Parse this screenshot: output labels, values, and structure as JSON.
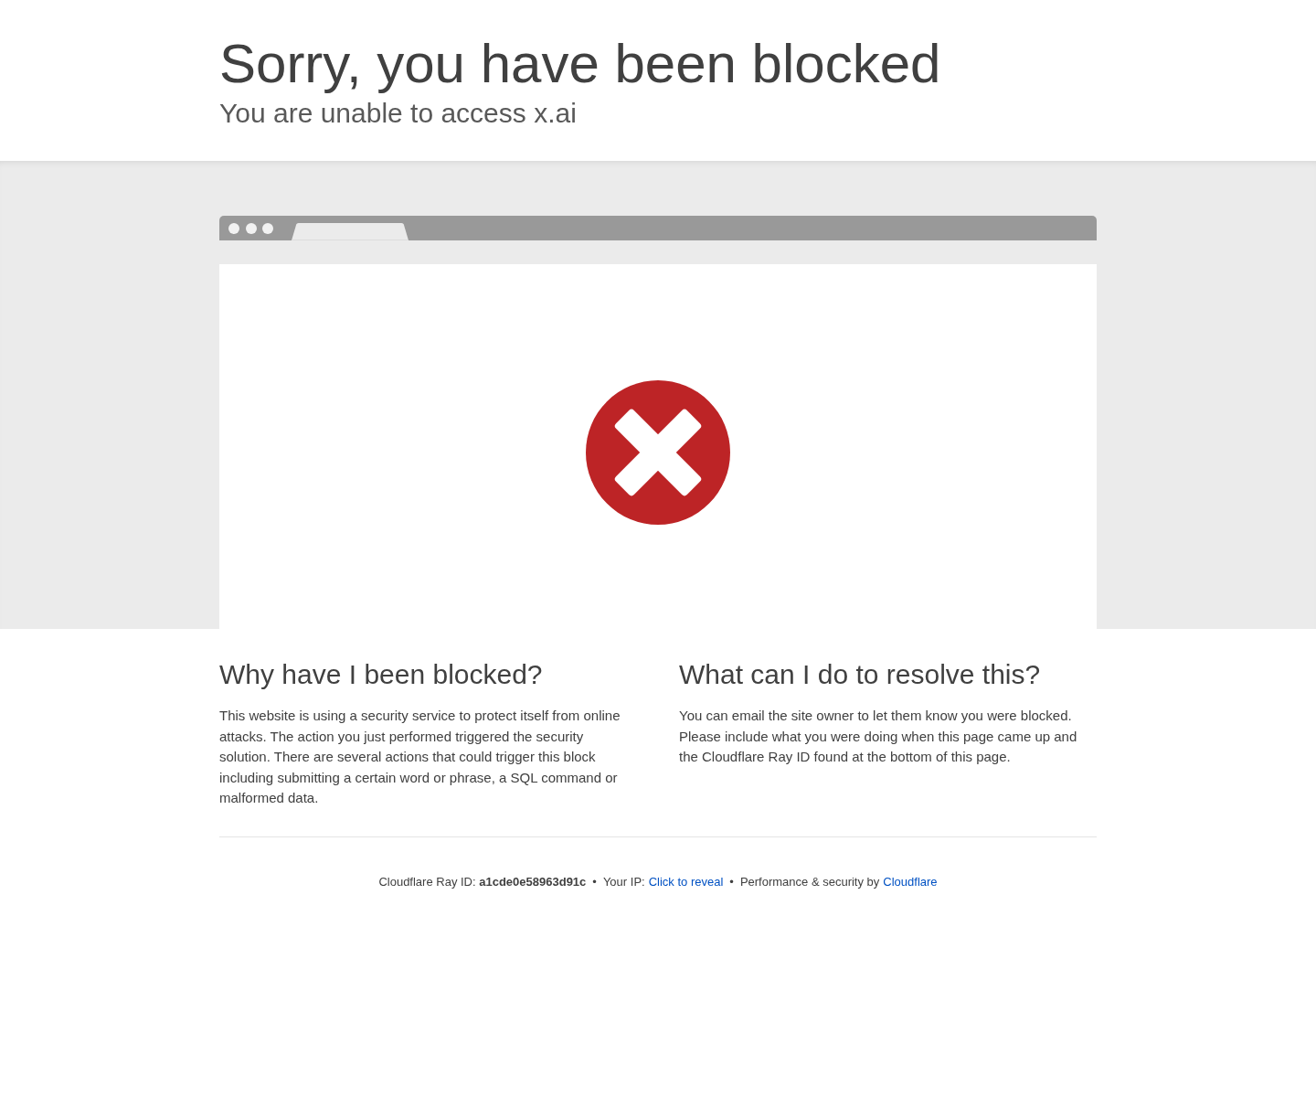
{
  "header": {
    "title": "Sorry, you have been blocked",
    "subtitle": "You are unable to access x.ai"
  },
  "sections": [
    {
      "heading": "Why have I been blocked?",
      "body": "This website is using a security service to protect itself from online attacks. The action you just performed triggered the security solution. There are several actions that could trigger this block including submitting a certain word or phrase, a SQL command or malformed data."
    },
    {
      "heading": "What can I do to resolve this?",
      "body": "You can email the site owner to let them know you were blocked. Please include what you were doing when this page came up and the Cloudflare Ray ID found at the bottom of this page."
    }
  ],
  "footer": [
    {
      "kind": "text",
      "text": "Cloudflare Ray ID: **a1cde0e58963d91c**"
    },
    {
      "kind": "separator",
      "text": "•"
    },
    {
      "kind": "text",
      "text": "Your IP:"
    },
    {
      "kind": "link",
      "text": "Click to reveal"
    },
    {
      "kind": "separator",
      "text": "•"
    },
    {
      "kind": "text",
      "text": "Performance & security by"
    },
    {
      "kind": "link",
      "text": "Cloudflare"
    }
  ]
}
